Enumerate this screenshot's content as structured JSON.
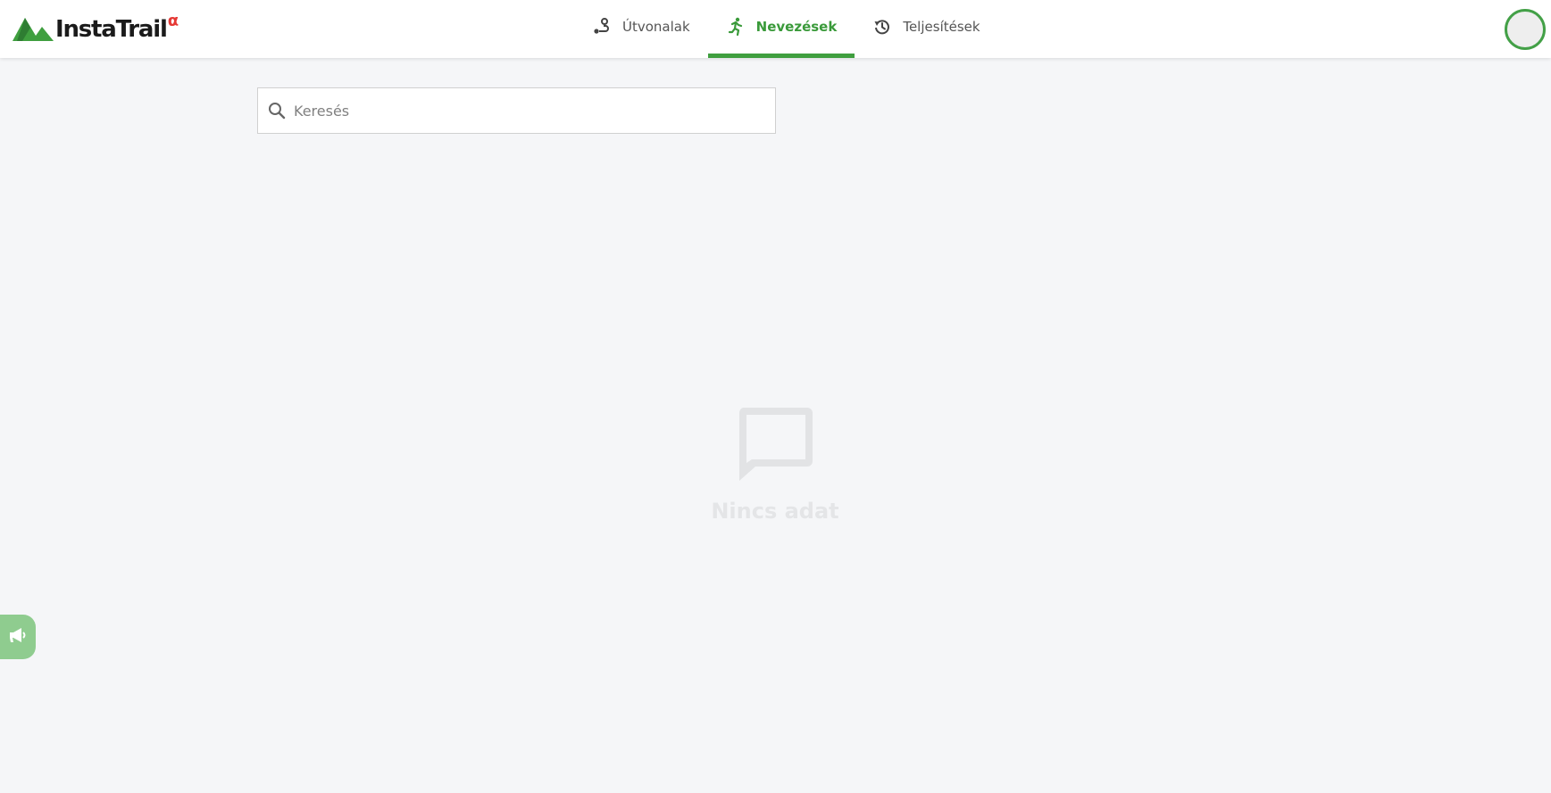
{
  "brand": {
    "name": "InstaTrail",
    "badge": "α",
    "logo_icon": "mountain-logo-icon"
  },
  "nav": {
    "tabs": [
      {
        "label": "Útvonalak",
        "icon": "route-icon",
        "active": false
      },
      {
        "label": "Nevezések",
        "icon": "running-person-icon",
        "active": true
      },
      {
        "label": "Teljesítések",
        "icon": "history-icon",
        "active": false
      }
    ]
  },
  "search": {
    "placeholder": "Keresés",
    "value": "",
    "icon": "search-icon"
  },
  "empty_state": {
    "icon": "chat-bubble-icon",
    "label": "Nincs adat"
  },
  "feedback": {
    "icon": "megaphone-icon"
  },
  "colors": {
    "accent": "#3f9f3f",
    "brand_red": "#e53935",
    "background": "#f5f6f8",
    "feedback_tab": "#8fcc8f"
  }
}
